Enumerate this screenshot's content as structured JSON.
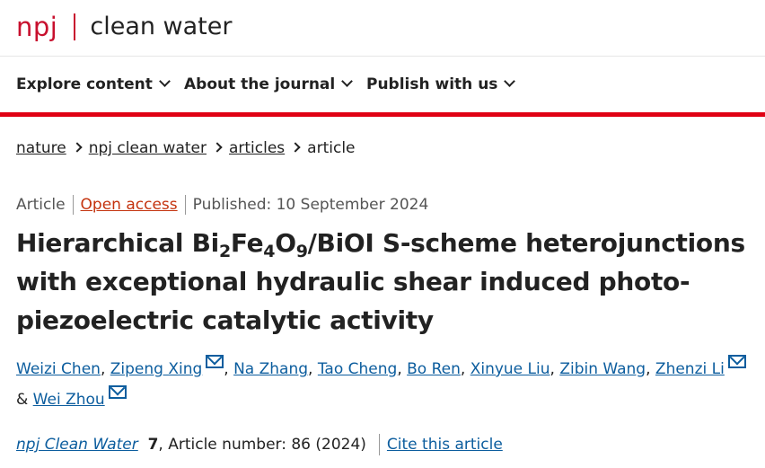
{
  "brand": {
    "npj": "npj",
    "journal": "clean water",
    "color": "#c8102e"
  },
  "nav": {
    "items": [
      {
        "label": "Explore content"
      },
      {
        "label": "About the journal"
      },
      {
        "label": "Publish with us"
      }
    ],
    "underline_color": "#e00014"
  },
  "breadcrumb": [
    "nature",
    "npj clean water",
    "articles",
    "article"
  ],
  "meta": {
    "type": "Article",
    "access": "Open access",
    "published": "Published: 10 September 2024"
  },
  "title": {
    "parts": [
      "Hierarchical Bi",
      "2",
      "Fe",
      "4",
      "O",
      "9",
      "/BiOI S-scheme heterojunctions with exceptional hydraulic shear induced photo-piezoelectric catalytic activity"
    ]
  },
  "authors": [
    {
      "name": "Weizi Chen"
    },
    {
      "name": "Zipeng Xing",
      "mail_icon": "envelope-icon"
    },
    {
      "name": "Na Zhang"
    },
    {
      "name": "Tao Cheng"
    },
    {
      "name": "Bo Ren"
    },
    {
      "name": "Xinyue Liu"
    },
    {
      "name": "Zibin Wang"
    },
    {
      "name": "Zhenzi Li",
      "mail_icon": "envelope-icon"
    },
    {
      "name": "Wei Zhou",
      "mail_icon": "envelope-icon"
    }
  ],
  "authors_sep": ", ",
  "authors_and": " & ",
  "citation": {
    "journal": "npj Clean Water",
    "volume": "7",
    "details": ", Article number: 86 (2024)",
    "cite_label": "Cite this article"
  },
  "colors": {
    "link": "#0c5d9e",
    "open_access": "#c4330e"
  }
}
